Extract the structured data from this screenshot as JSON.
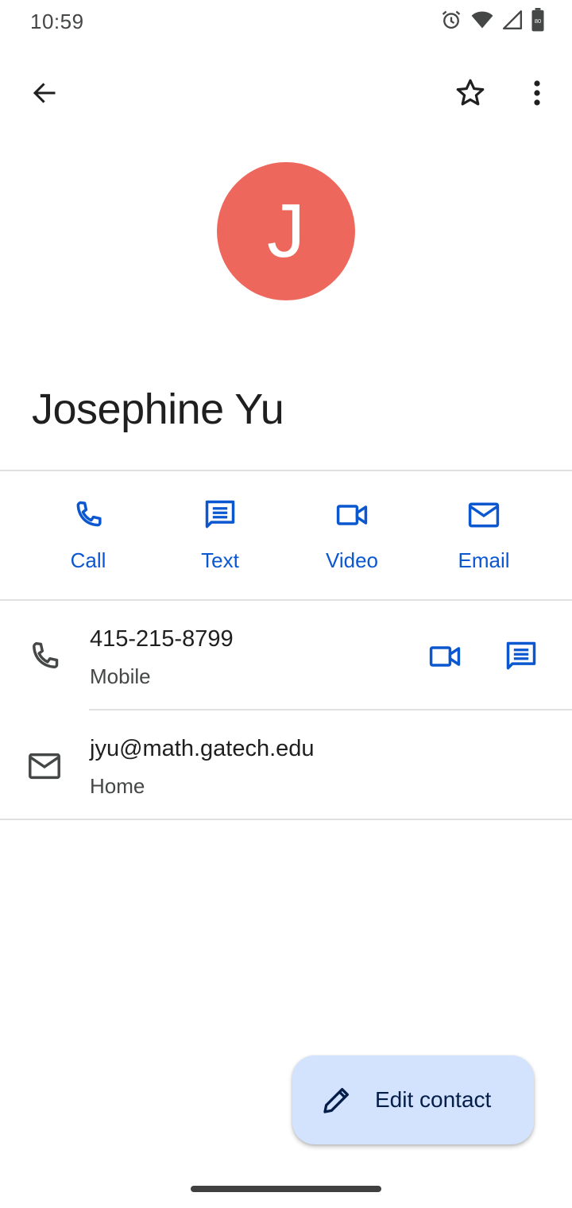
{
  "status_bar": {
    "time": "10:59",
    "battery_level": "80",
    "icons": [
      "alarm-icon",
      "wifi-icon",
      "signal-icon",
      "battery-icon"
    ]
  },
  "app_bar": {
    "icons": [
      "back-arrow-icon",
      "star-outline-icon",
      "more-vert-icon"
    ]
  },
  "contact": {
    "initial": "J",
    "name": "Josephine Yu",
    "avatar_color": "#ee675c"
  },
  "quick_actions": [
    {
      "label": "Call",
      "icon": "phone-icon"
    },
    {
      "label": "Text",
      "icon": "message-icon"
    },
    {
      "label": "Video",
      "icon": "videocam-icon"
    },
    {
      "label": "Email",
      "icon": "mail-icon"
    }
  ],
  "details": {
    "phone": {
      "value": "415-215-8799",
      "type": "Mobile"
    },
    "email": {
      "value": "jyu@math.gatech.edu",
      "type": "Home"
    }
  },
  "fab": {
    "label": "Edit contact",
    "icon": "pencil-icon"
  },
  "colors": {
    "accent": "#0b57d0",
    "fab_bg": "#d3e3fd",
    "text_primary": "#1f1f1f",
    "text_secondary": "#444746"
  }
}
